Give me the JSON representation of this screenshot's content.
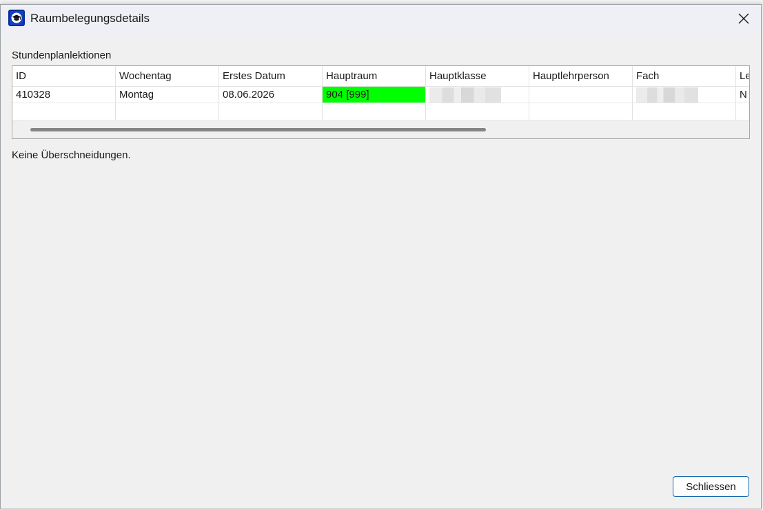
{
  "window": {
    "title": "Raumbelegungsdetails"
  },
  "section": {
    "label": "Stundenplanlektionen"
  },
  "table": {
    "columns": [
      "ID",
      "Wochentag",
      "Erstes Datum",
      "Hauptraum",
      "Hauptklasse",
      "Hauptlehrperson",
      "Fach",
      "Le"
    ],
    "rows": [
      {
        "id": "410328",
        "wochentag": "Montag",
        "erstes_datum": "08.06.2026",
        "hauptraum": "904 [999]",
        "hauptklasse": "",
        "hauptlehrperson": "",
        "fach": "",
        "le": "N"
      }
    ],
    "highlight_color": "#00ff00"
  },
  "status": {
    "text": "Keine Überschneidungen."
  },
  "footer": {
    "close_label": "Schliessen"
  },
  "icons": {
    "app": "graduation-cap-icon",
    "close": "close-icon"
  }
}
